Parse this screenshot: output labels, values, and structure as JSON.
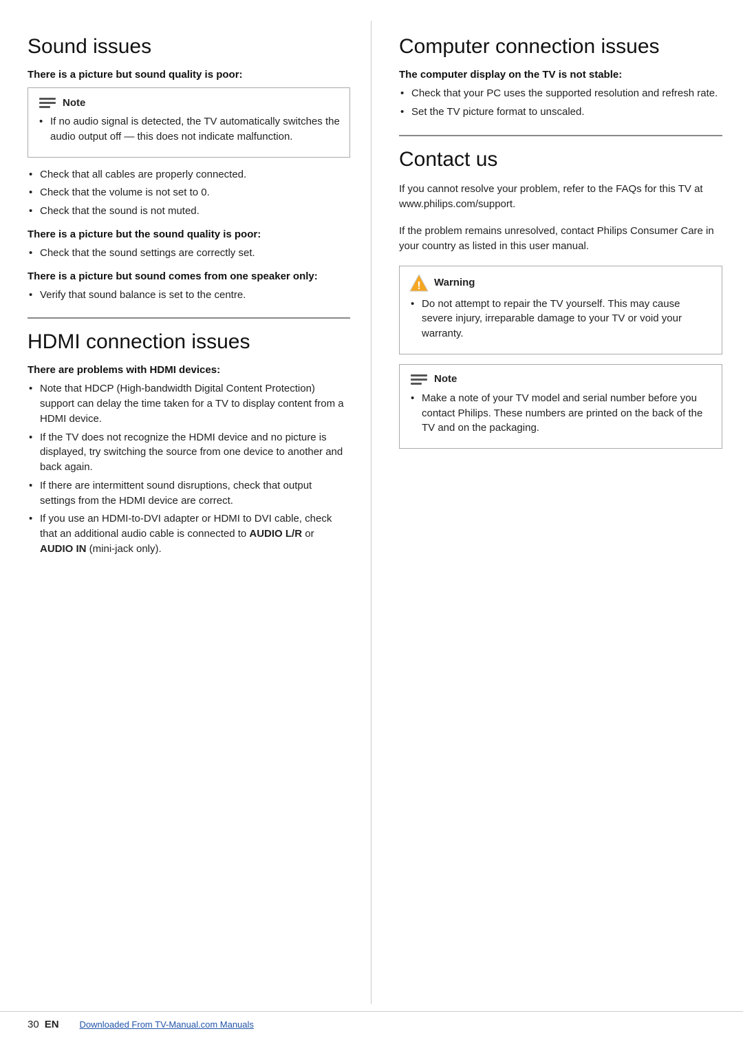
{
  "left": {
    "sound_issues": {
      "title": "Sound issues",
      "sub1": "There is a picture but sound quality is poor:",
      "note_label": "Note",
      "note_text": "If no audio signal is detected, the TV automatically switches the audio output off — this does not indicate malfunction.",
      "bullets1": [
        "Check that all cables are properly connected.",
        "Check that the volume is not set to 0.",
        "Check that the sound is not muted."
      ],
      "sub2": "There is a picture but the sound quality is poor:",
      "bullets2": [
        "Check that the sound settings are correctly set."
      ],
      "sub3": "There is a picture but sound comes from one speaker only:",
      "bullets3": [
        "Verify that sound balance is set to the centre."
      ]
    },
    "hdmi_issues": {
      "title": "HDMI connection issues",
      "sub1": "There are problems with HDMI devices:",
      "bullets": [
        "Note that HDCP (High-bandwidth Digital Content Protection) support can delay the time taken for a TV to display content from a HDMI device.",
        "If the TV does not recognize the HDMI device and no picture is displayed, try switching the source from one device to another and back again.",
        "If there are intermittent sound disruptions, check that output settings from the HDMI device are correct.",
        "If you use an HDMI-to-DVI adapter or HDMI to DVI cable, check that an additional audio cable is connected to AUDIO L/R or AUDIO IN (mini-jack only)."
      ],
      "audio_lr": "AUDIO L/R",
      "audio_in": "AUDIO IN"
    }
  },
  "right": {
    "computer_issues": {
      "title": "Computer connection issues",
      "sub1": "The computer display on the TV is not stable:",
      "bullets": [
        "Check that your PC uses the supported resolution and refresh rate.",
        "Set the TV picture format to unscaled."
      ]
    },
    "contact_us": {
      "title": "Contact us",
      "para1": "If you cannot resolve your problem, refer to the FAQs for this TV at www.philips.com/support.",
      "para2": "If the problem remains unresolved, contact Philips Consumer Care in your country as listed in this user manual.",
      "warning_label": "Warning",
      "warning_text": "Do not attempt to repair the TV yourself. This may cause severe injury, irreparable damage to your TV or void your warranty.",
      "note_label": "Note",
      "note_text": "Make a note of your TV model and serial number before you contact Philips. These numbers are printed on the back of the TV and on the packaging."
    }
  },
  "footer": {
    "page_number": "30",
    "language": "EN",
    "link_text": "Downloaded From TV-Manual.com Manuals"
  }
}
